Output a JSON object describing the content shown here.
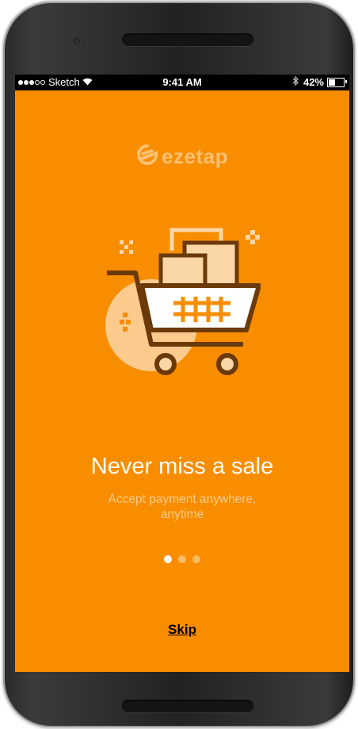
{
  "status_bar": {
    "carrier": "Sketch",
    "time": "9:41 AM",
    "battery_percent": "42%",
    "battery_level": 0.42,
    "icons": [
      "signal-dots-icon",
      "wifi-icon",
      "bluetooth-icon",
      "battery-icon"
    ]
  },
  "brand": {
    "name": "ezetap",
    "icon": "ezetap-logo-icon"
  },
  "onboarding": {
    "illustration": "shopping-cart-icon",
    "title": "Never miss a sale",
    "subtitle": "Accept payment anywhere, anytime",
    "page_count": 3,
    "active_page": 1,
    "skip_label": "Skip"
  },
  "colors": {
    "background": "#F98D00",
    "cart_outline": "#6B3A0A",
    "cart_fill": "#FBD6A6",
    "text": "#FFFFFF"
  }
}
